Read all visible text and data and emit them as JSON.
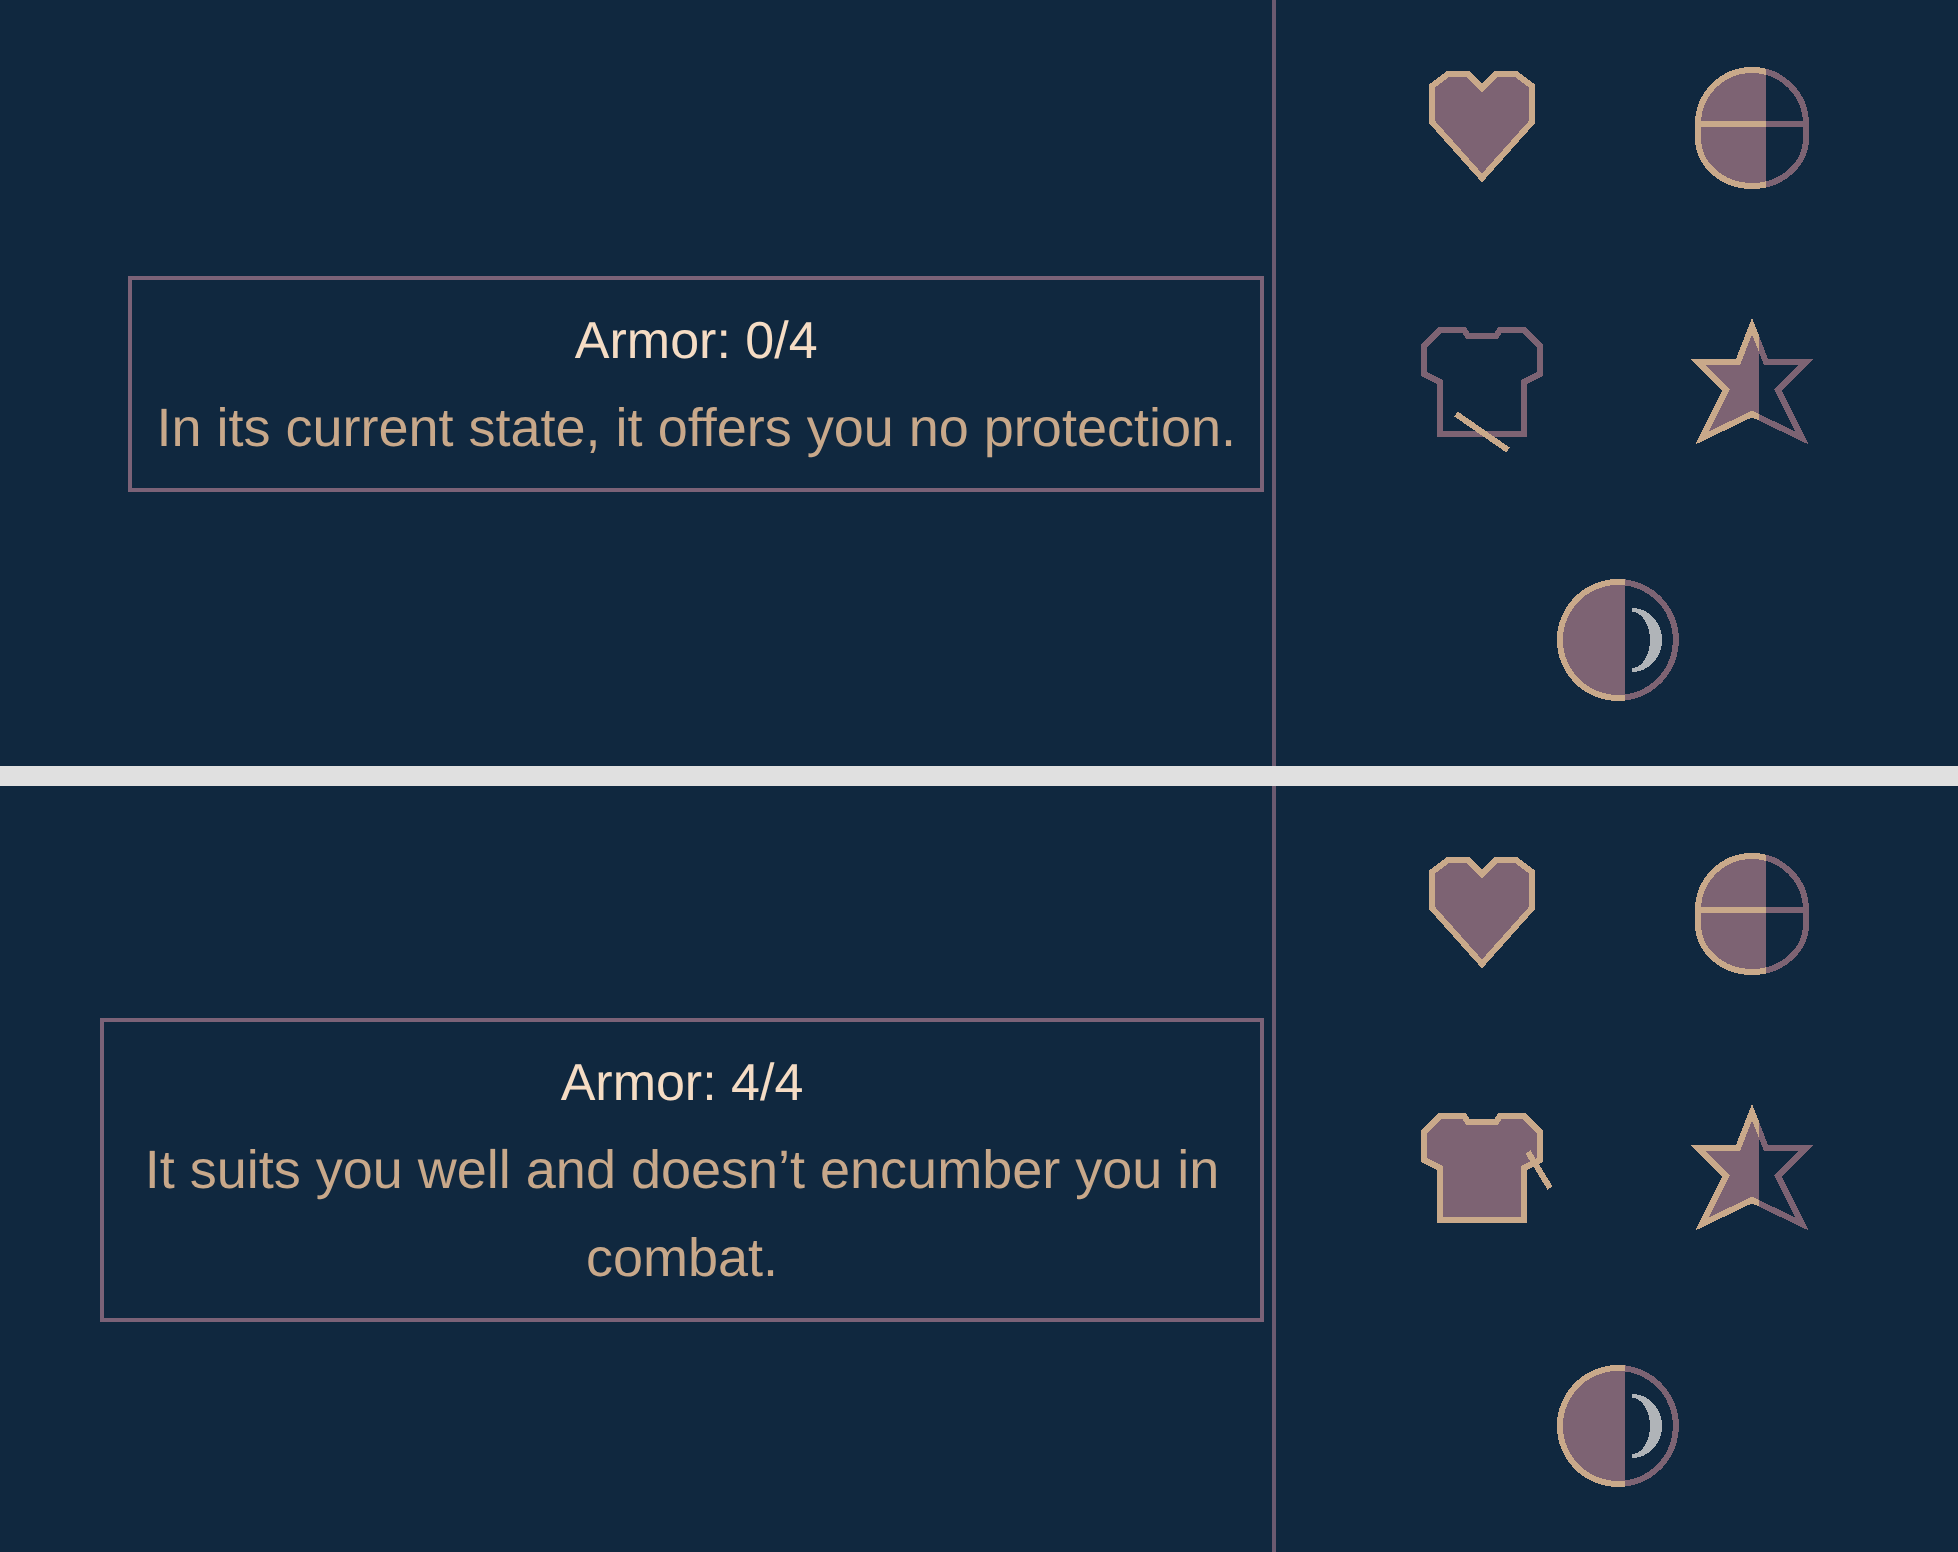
{
  "panels": [
    {
      "tooltip": {
        "title": "Armor: 0/4",
        "description": "In its current state, it offers you no protection."
      },
      "icons": [
        {
          "kind": "heart"
        },
        {
          "kind": "helmet"
        },
        {
          "kind": "armor",
          "filled": false
        },
        {
          "kind": "star"
        },
        {
          "kind": "orb"
        }
      ]
    },
    {
      "tooltip": {
        "title": "Armor: 4/4",
        "description": "It suits you well and doesn’t encumber you in combat."
      },
      "icons": [
        {
          "kind": "heart"
        },
        {
          "kind": "helmet"
        },
        {
          "kind": "armor",
          "filled": true
        },
        {
          "kind": "star"
        },
        {
          "kind": "orb"
        }
      ]
    }
  ]
}
